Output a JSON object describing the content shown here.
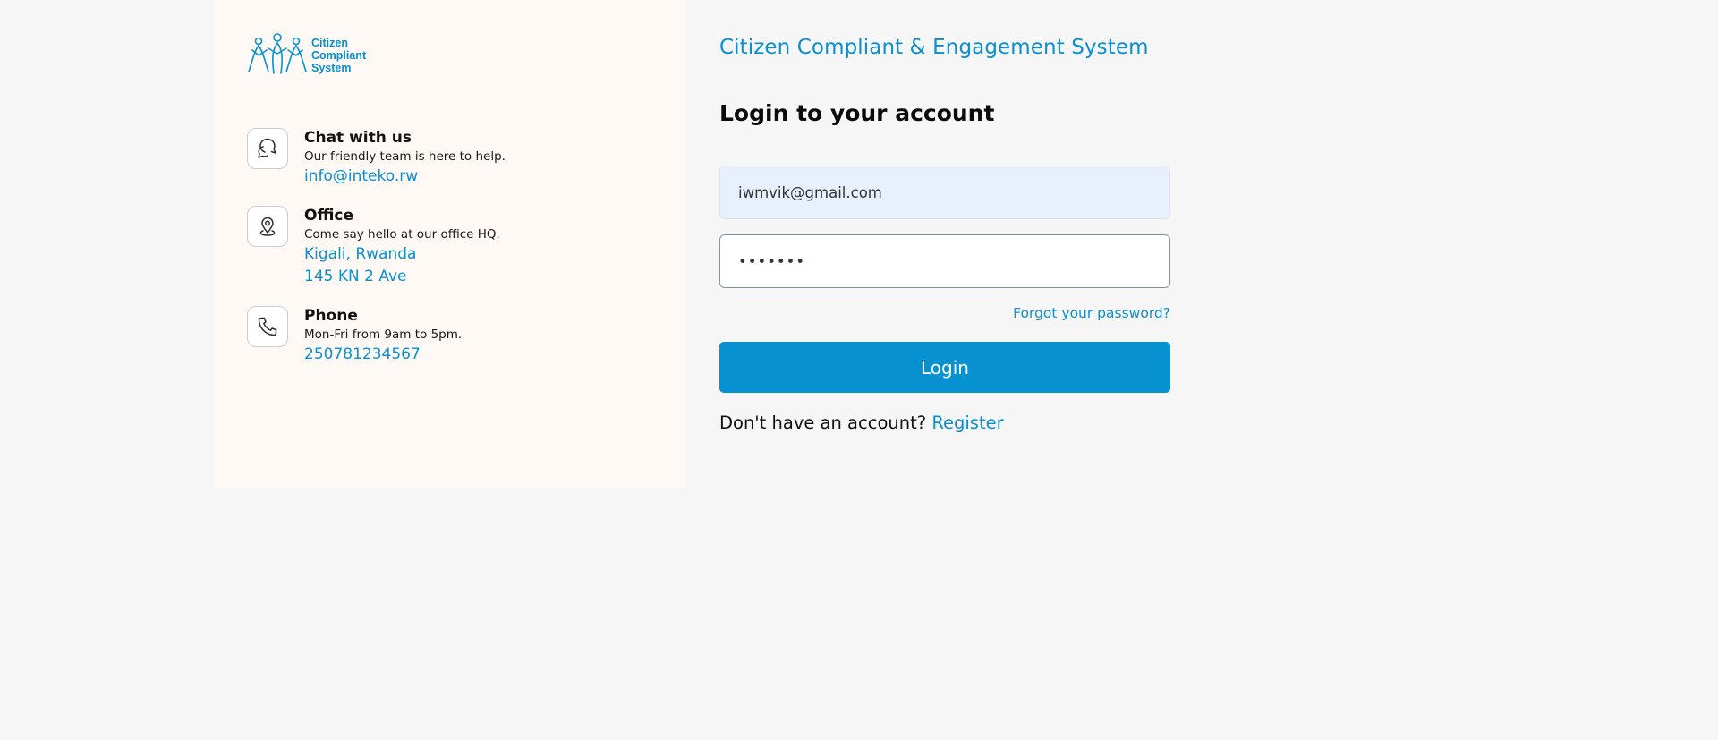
{
  "brand": {
    "logo_text_line1": "Citizen",
    "logo_text_line2": "Compliant",
    "logo_text_line3": "System",
    "accent_color": "#0891d1"
  },
  "contacts": [
    {
      "icon": "chat-bubbles-icon",
      "title": "Chat with us",
      "subtitle": "Our friendly team is here to help.",
      "links": [
        "info@inteko.rw"
      ]
    },
    {
      "icon": "location-pin-icon",
      "title": "Office",
      "subtitle": "Come say hello at our office HQ.",
      "links": [
        "Kigali, Rwanda",
        "145 KN 2 Ave"
      ]
    },
    {
      "icon": "phone-icon",
      "title": "Phone",
      "subtitle": "Mon-Fri from 9am to 5pm.",
      "links": [
        "250781234567"
      ]
    }
  ],
  "form": {
    "system_title": "Citizen Compliant & Engagement System",
    "heading": "Login to your account",
    "email_value": "iwmvik@gmail.com",
    "password_value": "•••••••",
    "forgot_label": "Forgot your password?",
    "login_label": "Login",
    "no_account_text": "Don't have an account?",
    "register_label": "Register"
  }
}
